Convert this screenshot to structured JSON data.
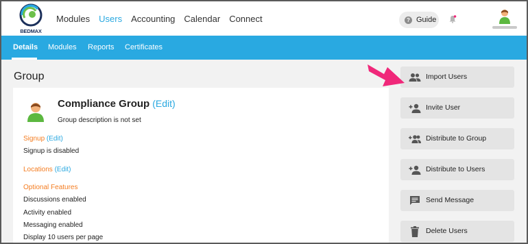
{
  "brand": {
    "name": "BEDMAX"
  },
  "main_nav": {
    "items": [
      {
        "label": "Modules",
        "active": false
      },
      {
        "label": "Users",
        "active": true
      },
      {
        "label": "Accounting",
        "active": false
      },
      {
        "label": "Calendar",
        "active": false
      },
      {
        "label": "Connect",
        "active": false
      }
    ]
  },
  "header": {
    "guide_label": "Guide",
    "guide_icon": "question-icon",
    "notification_icon": "bell-icon"
  },
  "sub_nav": {
    "tabs": [
      {
        "label": "Details",
        "active": true
      },
      {
        "label": "Modules",
        "active": false
      },
      {
        "label": "Reports",
        "active": false
      },
      {
        "label": "Certificates",
        "active": false
      }
    ]
  },
  "page": {
    "heading": "Group"
  },
  "group": {
    "name": "Compliance Group",
    "edit_label": "(Edit)",
    "description": "Group description is not set",
    "signup_label": "Signup",
    "signup_edit": "(Edit)",
    "signup_status": "Signup is disabled",
    "locations_label": "Locations",
    "locations_edit": "(Edit)",
    "optional_features_label": "Optional Features",
    "features": [
      "Discussions enabled",
      "Activity enabled",
      "Messaging enabled",
      "Display 10 users per page"
    ]
  },
  "actions": [
    {
      "label": "Import Users",
      "icon": "group-icon"
    },
    {
      "label": "Invite User",
      "icon": "person-add-icon"
    },
    {
      "label": "Distribute to Group",
      "icon": "group-add-icon"
    },
    {
      "label": "Distribute to Users",
      "icon": "person-add-icon"
    },
    {
      "label": "Send Message",
      "icon": "message-icon"
    },
    {
      "label": "Delete Users",
      "icon": "trash-icon"
    }
  ],
  "colors": {
    "accent": "#29a9e1",
    "orange": "#f47c20",
    "arrow": "#f0287a"
  }
}
